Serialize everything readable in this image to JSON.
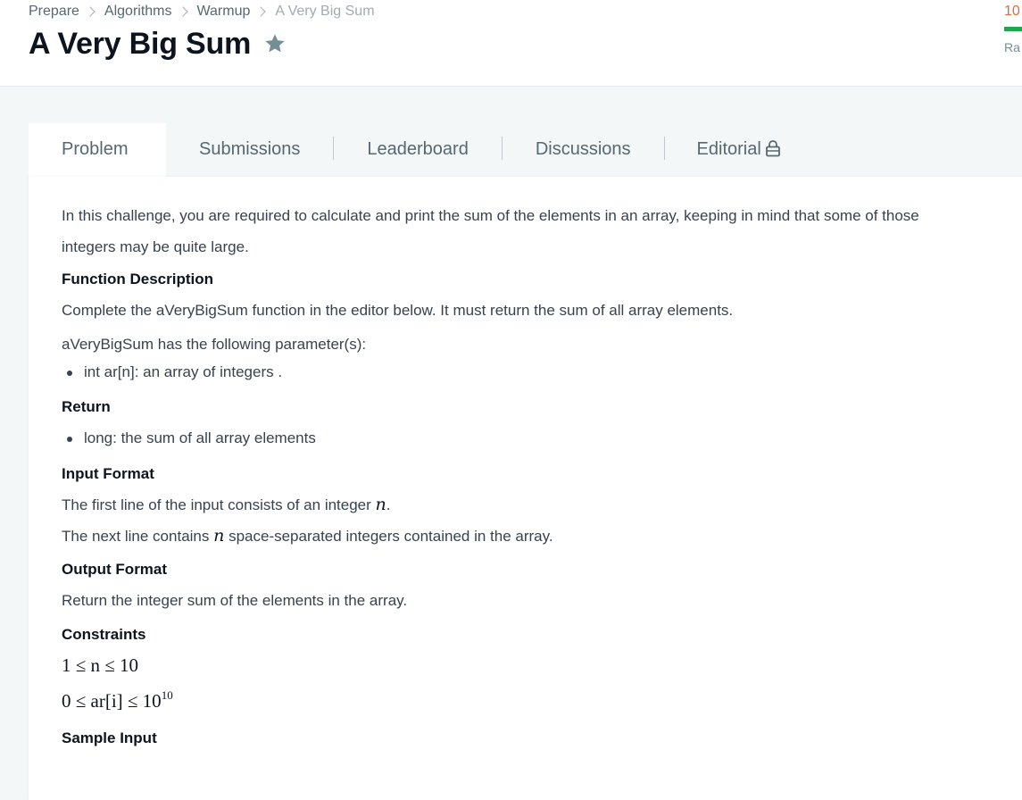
{
  "breadcrumb": {
    "items": [
      "Prepare",
      "Algorithms",
      "Warmup"
    ],
    "current": "A Very Big Sum"
  },
  "page": {
    "title": "A Very Big Sum",
    "score_partial": "10",
    "rank_partial": "Ra"
  },
  "tabs": [
    {
      "label": "Problem",
      "active": true
    },
    {
      "label": "Submissions",
      "active": false
    },
    {
      "label": "Leaderboard",
      "active": false
    },
    {
      "label": "Discussions",
      "active": false
    },
    {
      "label": "Editorial",
      "active": false,
      "icon": "lock-icon"
    }
  ],
  "problem": {
    "intro": "In this challenge, you are required to calculate and print the sum of the elements in an array, keeping in mind that some of those integers may be quite large.",
    "function_description_heading": "Function Description",
    "function_description": "Complete the aVeryBigSum function in the editor below. It must return the sum of all array elements.",
    "parameters_intro": "aVeryBigSum has the following parameter(s):",
    "parameters": [
      "int ar[n]: an array of integers ."
    ],
    "return_heading": "Return",
    "return_items": [
      "long: the sum of all array elements"
    ],
    "input_format_heading": "Input Format",
    "input_line1_pre": "The first line of the input consists of an integer ",
    "input_line1_var": "n",
    "input_line1_post": ".",
    "input_line2_pre": "The next line contains ",
    "input_line2_var": "n",
    "input_line2_post": " space-separated integers contained in the array.",
    "output_format_heading": "Output Format",
    "output_format": "Return the integer sum of the elements in the array.",
    "constraints_heading": "Constraints",
    "constraint1": "1 ≤ n ≤ 10",
    "constraint2_base": "0 ≤ ar[i] ≤ 10",
    "constraint2_exp": "10",
    "sample_input_heading": "Sample Input"
  },
  "colors": {
    "accent_green": "#1ba94c",
    "score_orange": "#e06a4a",
    "title": "#0e141e",
    "body_text": "#39424e"
  }
}
